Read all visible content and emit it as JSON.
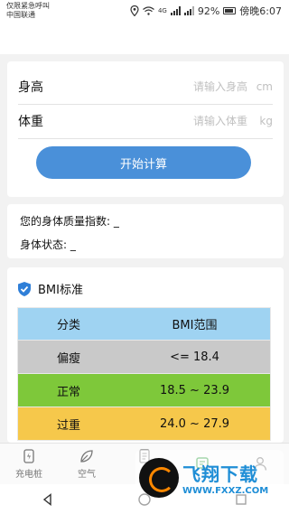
{
  "status_bar": {
    "carrier_line1": "仅限紧急呼叫",
    "carrier_line2": "中国联通",
    "network": "4G",
    "battery": "92%",
    "time": "傍晚6:07"
  },
  "form": {
    "height_label": "身高",
    "height_placeholder": "请输入身高",
    "height_unit": "cm",
    "weight_label": "体重",
    "weight_placeholder": "请输入体重",
    "weight_unit": "kg",
    "submit_label": "开始计算"
  },
  "result": {
    "bmi_line": "您的身体质量指数: _",
    "status_line": "身体状态: _"
  },
  "bmi_standard": {
    "title": "BMI标准",
    "headers": [
      "分类",
      "BMI范围"
    ],
    "rows": [
      {
        "category": "偏瘦",
        "range": "<= 18.4"
      },
      {
        "category": "正常",
        "range": "18.5 ~ 23.9"
      },
      {
        "category": "过重",
        "range": "24.0 ~ 27.9"
      }
    ],
    "colors": {
      "header": "#9fd3f2",
      "row_underweight": "#c9c9c9",
      "row_normal": "#7ec83a",
      "row_overweight": "#f6c84b"
    }
  },
  "bottom_nav": {
    "items": [
      {
        "label": "充电桩",
        "icon": "charging-icon"
      },
      {
        "label": "空气",
        "icon": "leaf-icon"
      },
      {
        "label": "日",
        "icon": "document-icon"
      },
      {
        "label": "",
        "icon": "chat-icon"
      },
      {
        "label": "",
        "icon": "person-icon"
      }
    ]
  },
  "watermark": {
    "main": "飞翔下载",
    "sub": "WWW.FXXZ.COM"
  },
  "accent": "#4a90d9"
}
